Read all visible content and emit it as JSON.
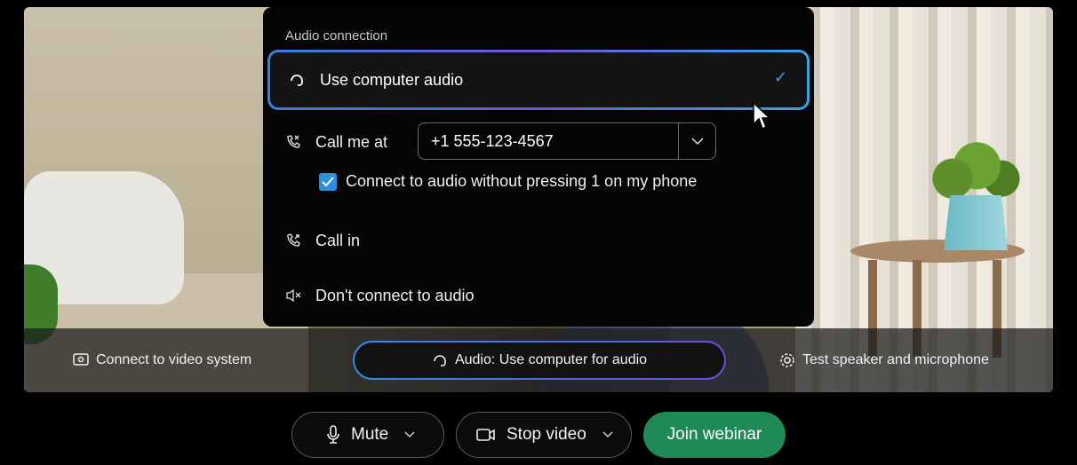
{
  "popup": {
    "title": "Audio connection",
    "options": {
      "computer": {
        "label": "Use computer audio",
        "selected": true
      },
      "call_me": {
        "label": "Call me at",
        "phone_value": "+1 555-123-4567"
      },
      "no_press": {
        "label": "Connect to audio without pressing 1 on my phone",
        "checked": true
      },
      "call_in": {
        "label": "Call in"
      },
      "none": {
        "label": "Don't connect to audio"
      }
    }
  },
  "preview_bar": {
    "video_system": "Connect to video system",
    "audio": "Audio: Use computer for audio",
    "test": "Test speaker and microphone"
  },
  "controls": {
    "mute": "Mute",
    "stop_video": "Stop video",
    "join": "Join webinar"
  },
  "colors": {
    "accent_blue": "#2c8fe0",
    "accent_purple": "#6e55d8",
    "join_green": "#1f8a55"
  }
}
